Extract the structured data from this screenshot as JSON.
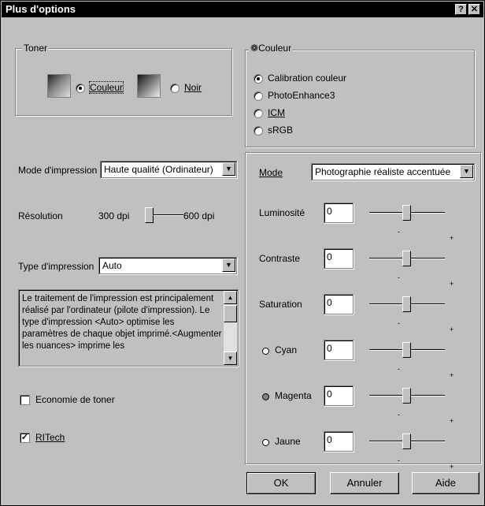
{
  "window": {
    "title": "Plus d'options",
    "help_btn": "?",
    "close_btn": "✕"
  },
  "toner": {
    "legend": "Toner",
    "color_label": "Couleur",
    "black_label": "Noir"
  },
  "couleur": {
    "legend": "Couleur",
    "options": [
      "Calibration couleur",
      "PhotoEnhance3",
      "ICM",
      "sRGB"
    ]
  },
  "left": {
    "mode_label": "Mode d'impression",
    "mode_value": "Haute qualité (Ordinateur)",
    "resolution_label": "Résolution",
    "res_low": "300 dpi",
    "res_high": "600 dpi",
    "type_label": "Type d'impression",
    "type_value": "Auto",
    "description": "Le traitement de l'impression est principalement réalisé par l'ordinateur (pilote d'impression). Le type d'impression <Auto> optimise les paramètres de chaque objet imprimé.<Augmenter les nuances> imprime les",
    "economie_label": "Economie de toner",
    "ritech_label": "RITech"
  },
  "right": {
    "mode_label": "Mode",
    "mode_value": "Photographie réaliste accentuée",
    "sliders": [
      {
        "label": "Luminosité",
        "value": "0",
        "level": 0.5
      },
      {
        "label": "Contraste",
        "value": "0",
        "level": 0.5
      },
      {
        "label": "Saturation",
        "value": "0",
        "level": 0.5
      },
      {
        "label": "Cyan",
        "value": "0",
        "level": 0.5
      },
      {
        "label": "Magenta",
        "value": "0",
        "level": 0.5
      },
      {
        "label": "Jaune",
        "value": "0",
        "level": 0.5
      }
    ],
    "minus": "-",
    "plus": "+"
  },
  "buttons": {
    "ok": "OK",
    "cancel": "Annuler",
    "help": "Aide"
  }
}
